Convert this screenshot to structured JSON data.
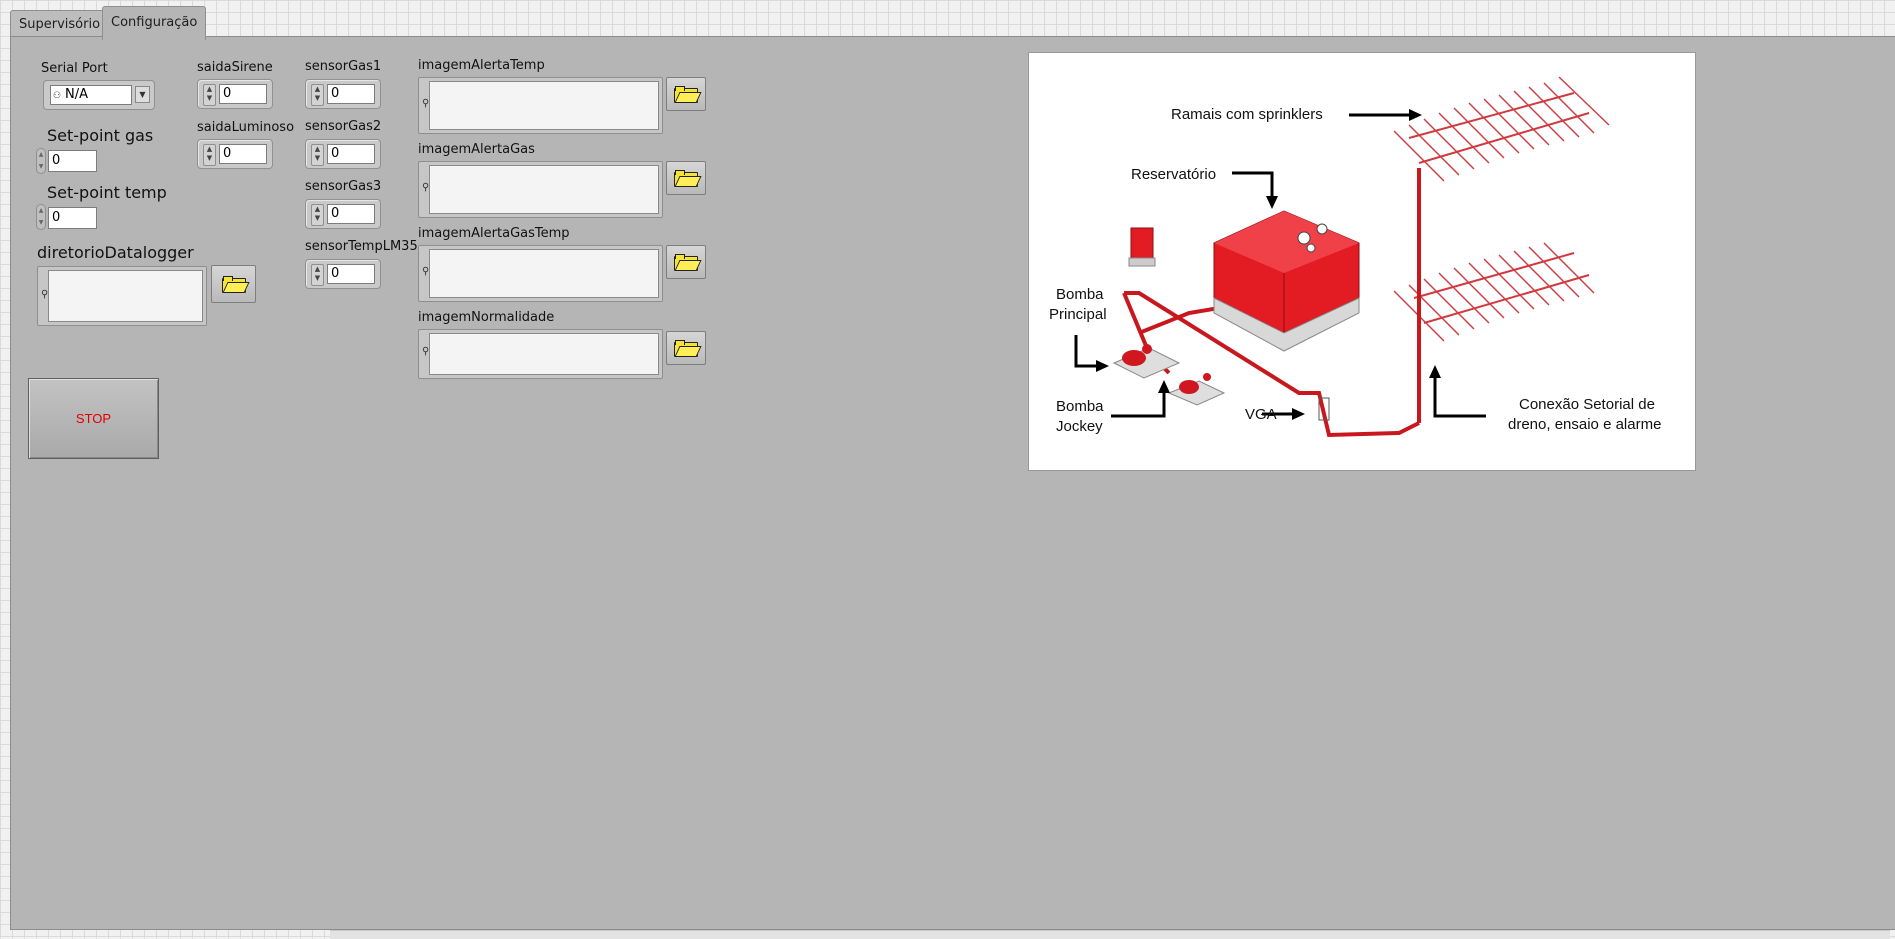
{
  "tabs": [
    {
      "label": "Supervisório",
      "active": false
    },
    {
      "label": "Configuração",
      "active": true
    }
  ],
  "serial": {
    "label": "Serial Port",
    "value": "N/A"
  },
  "setpoints": {
    "gas": {
      "label": "Set-point gas",
      "value": "0"
    },
    "temp": {
      "label": "Set-point temp",
      "value": "0"
    }
  },
  "datalogger": {
    "label": "diretorioDatalogger",
    "value": ""
  },
  "outputs": {
    "sirene": {
      "label": "saidaSirene",
      "value": "0"
    },
    "luminoso": {
      "label": "saidaLuminoso",
      "value": "0"
    }
  },
  "sensors": [
    {
      "label": "sensorGas1",
      "value": "0"
    },
    {
      "label": "sensorGas2",
      "value": "0"
    },
    {
      "label": "sensorGas3",
      "value": "0"
    },
    {
      "label": "sensorTempLM35",
      "value": "0"
    }
  ],
  "images": [
    {
      "label": "imagemAlertaTemp",
      "value": ""
    },
    {
      "label": "imagemAlertaGas",
      "value": ""
    },
    {
      "label": "imagemAlertaGasTemp",
      "value": ""
    },
    {
      "label": "imagemNormalidade",
      "value": ""
    }
  ],
  "stop_label": "STOP",
  "diagram": {
    "ramais": "Ramais com sprinklers",
    "reservatorio": "Reservatório",
    "bomba_principal_1": "Bomba",
    "bomba_principal_2": "Principal",
    "bomba_jockey_1": "Bomba",
    "bomba_jockey_2": "Jockey",
    "vga": "VGA",
    "conexao_1": "Conexão Setorial de",
    "conexao_2": "dreno, ensaio e alarme"
  },
  "colors": {
    "stop_text": "#e00000",
    "pipe_red": "#c8181e",
    "panel_bg": "#b5b5b5"
  }
}
